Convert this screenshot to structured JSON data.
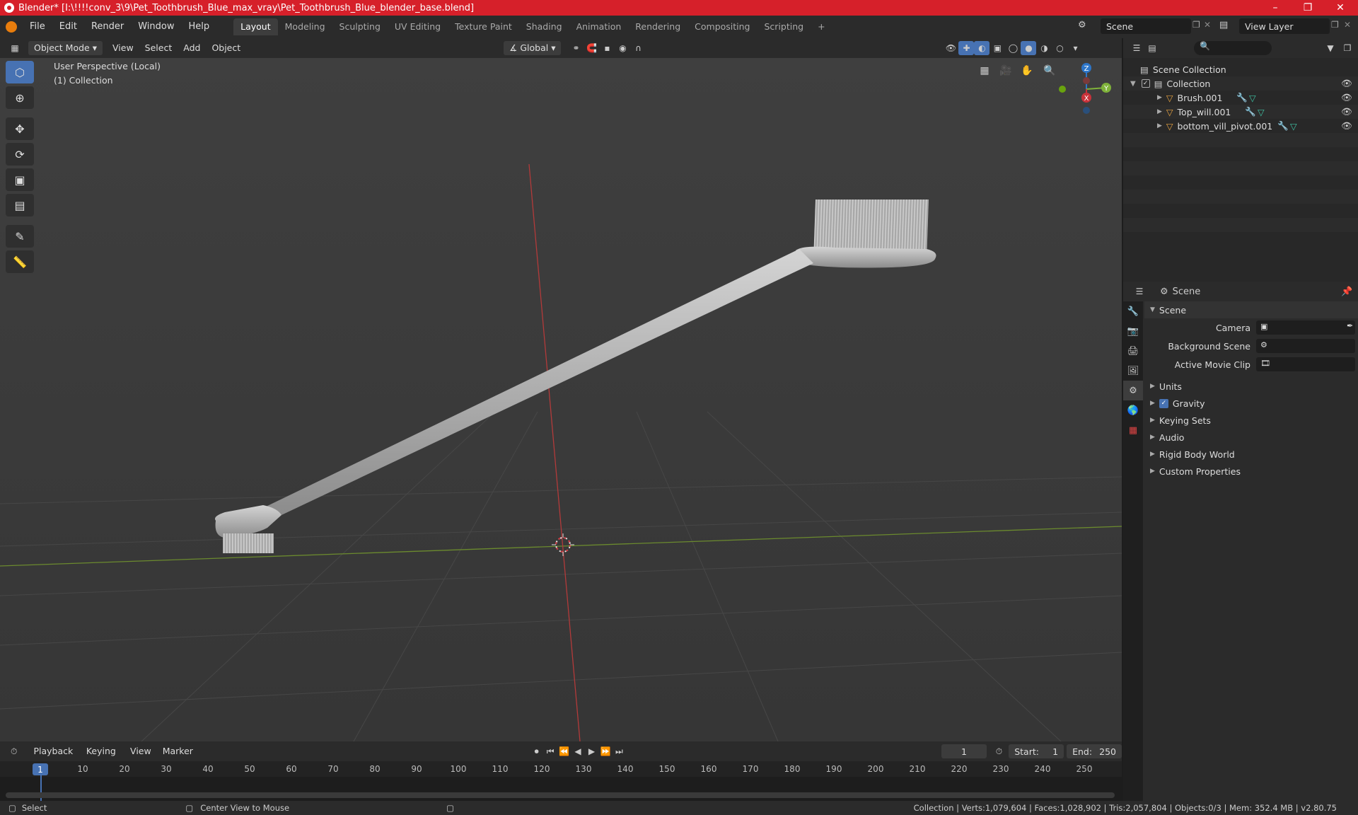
{
  "window": {
    "title": "Blender* [I:\\!!!!conv_3\\9\\Pet_Toothbrush_Blue_max_vray\\Pet_Toothbrush_Blue_blender_base.blend]",
    "minimize": "–",
    "maximize": "❐",
    "close": "✕"
  },
  "menu": [
    "File",
    "Edit",
    "Render",
    "Window",
    "Help"
  ],
  "workspaces": [
    "Layout",
    "Modeling",
    "Sculpting",
    "UV Editing",
    "Texture Paint",
    "Shading",
    "Animation",
    "Rendering",
    "Compositing",
    "Scripting"
  ],
  "add_workspace": "+",
  "scene_selector": "Scene",
  "view_layer_selector": "View Layer",
  "viewport_header": {
    "mode": "Object Mode",
    "menus": [
      "View",
      "Select",
      "Add",
      "Object"
    ],
    "transform_orientation": "Global"
  },
  "viewport": {
    "perspective": "User Perspective (Local)",
    "collection": "(1) Collection",
    "gizmo_axes": {
      "z": "Z",
      "y": "Y",
      "x": "X"
    }
  },
  "outliner": {
    "root": "Scene Collection",
    "collection": "Collection",
    "objects": [
      "Brush.001",
      "Top_will.001",
      "bottom_vill_pivot.001"
    ]
  },
  "properties": {
    "header": "Scene",
    "panel": "Scene",
    "fields": [
      {
        "label": "Camera",
        "value": ""
      },
      {
        "label": "Background Scene",
        "value": ""
      },
      {
        "label": "Active Movie Clip",
        "value": ""
      }
    ],
    "sections": [
      "Units",
      "Gravity",
      "Keying Sets",
      "Audio",
      "Rigid Body World",
      "Custom Properties"
    ]
  },
  "timeline": {
    "menus": [
      "Playback",
      "Keying",
      "View",
      "Marker"
    ],
    "current_frame": "1",
    "start_label": "Start:",
    "start": "1",
    "end_label": "End:",
    "end": "250",
    "ruler": [
      "10",
      "20",
      "30",
      "40",
      "50",
      "60",
      "70",
      "80",
      "90",
      "100",
      "110",
      "120",
      "130",
      "140",
      "150",
      "160",
      "170",
      "180",
      "190",
      "200",
      "210",
      "220",
      "230",
      "240",
      "250"
    ],
    "marker": "1"
  },
  "status": {
    "left": "Select",
    "middle": "Center View to Mouse",
    "right": "Collection | Verts:1,079,604 | Faces:1,028,902 | Tris:2,057,804 | Objects:0/3 | Mem: 352.4 MB | v2.80.75"
  },
  "colors": {
    "title_bar": "#d6202a",
    "accent": "#4772b3",
    "x_axis": "#c9323a",
    "y_axis": "#7fb23a",
    "z_axis": "#2d76c9"
  }
}
